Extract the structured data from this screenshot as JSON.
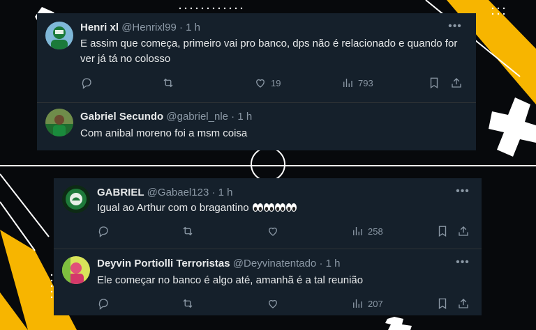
{
  "colors": {
    "card_bg": "#15202b",
    "text": "#e7e9ea",
    "muted": "#8b98a5",
    "accent_yellow": "#f7b500"
  },
  "card_top": {
    "tweets": [
      {
        "name": "Henri xl",
        "handle": "@Henrixl99",
        "time": "· 1 h",
        "text": "E assim que começa, primeiro vai pro banco, dps não é relacionado e quando for ver já tá no colosso",
        "likes": "19",
        "views": "793"
      },
      {
        "name": "Gabriel Secundo",
        "handle": "@gabriel_nle",
        "time": "· 1 h",
        "text": "Com anibal moreno foi a msm coisa"
      }
    ]
  },
  "card_bottom": {
    "tweets": [
      {
        "name": "GABRIEL",
        "handle": "@Gabael123",
        "time": "· 1 h",
        "text": "Igual ao Arthur com o bragantino",
        "emoji": "eyes-emoji",
        "views": "258"
      },
      {
        "name": "Deyvin Portiolli Terroristas",
        "handle": "@Deyvinatentado",
        "time": "· 1 h",
        "text": "Ele começar no banco é algo até, amanhã é a tal reunião",
        "views": "207"
      }
    ]
  },
  "icons": [
    "reply-icon",
    "retweet-icon",
    "like-icon",
    "views-icon",
    "bookmark-icon",
    "share-icon",
    "more-icon"
  ]
}
